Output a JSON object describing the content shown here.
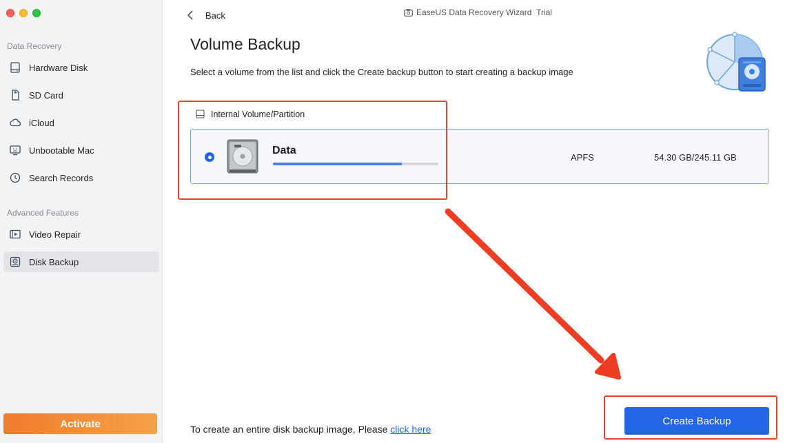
{
  "window": {
    "title": "EaseUS Data Recovery Wizard",
    "badge": "Trial"
  },
  "sidebar": {
    "section1": "Data Recovery",
    "items": [
      {
        "label": "Hardware Disk",
        "icon": "hardware-disk-icon"
      },
      {
        "label": "SD Card",
        "icon": "sd-card-icon"
      },
      {
        "label": "iCloud",
        "icon": "cloud-icon"
      },
      {
        "label": "Unbootable Mac",
        "icon": "unbootable-mac-icon"
      },
      {
        "label": "Search Records",
        "icon": "history-icon"
      }
    ],
    "section2": "Advanced Features",
    "items2": [
      {
        "label": "Video Repair",
        "icon": "video-icon"
      },
      {
        "label": "Disk Backup",
        "icon": "disk-backup-icon",
        "active": true
      }
    ],
    "activate_label": "Activate"
  },
  "header": {
    "back_label": "Back"
  },
  "main": {
    "title": "Volume Backup",
    "description": "Select a volume from the list and click the Create backup button to start creating a backup image",
    "group_label": "Internal Volume/Partition",
    "volume": {
      "name": "Data",
      "filesystem": "APFS",
      "size": "54.30 GB/245.11 GB",
      "usage_fraction": 0.78,
      "selected": true
    },
    "footer_text": "To create an entire disk backup image, Please ",
    "footer_link": "click here",
    "create_button": "Create Backup"
  },
  "colors": {
    "accent": "#2465e7",
    "highlight": "#e5432a",
    "activate_start": "#f07b2c",
    "activate_end": "#f5a245"
  }
}
